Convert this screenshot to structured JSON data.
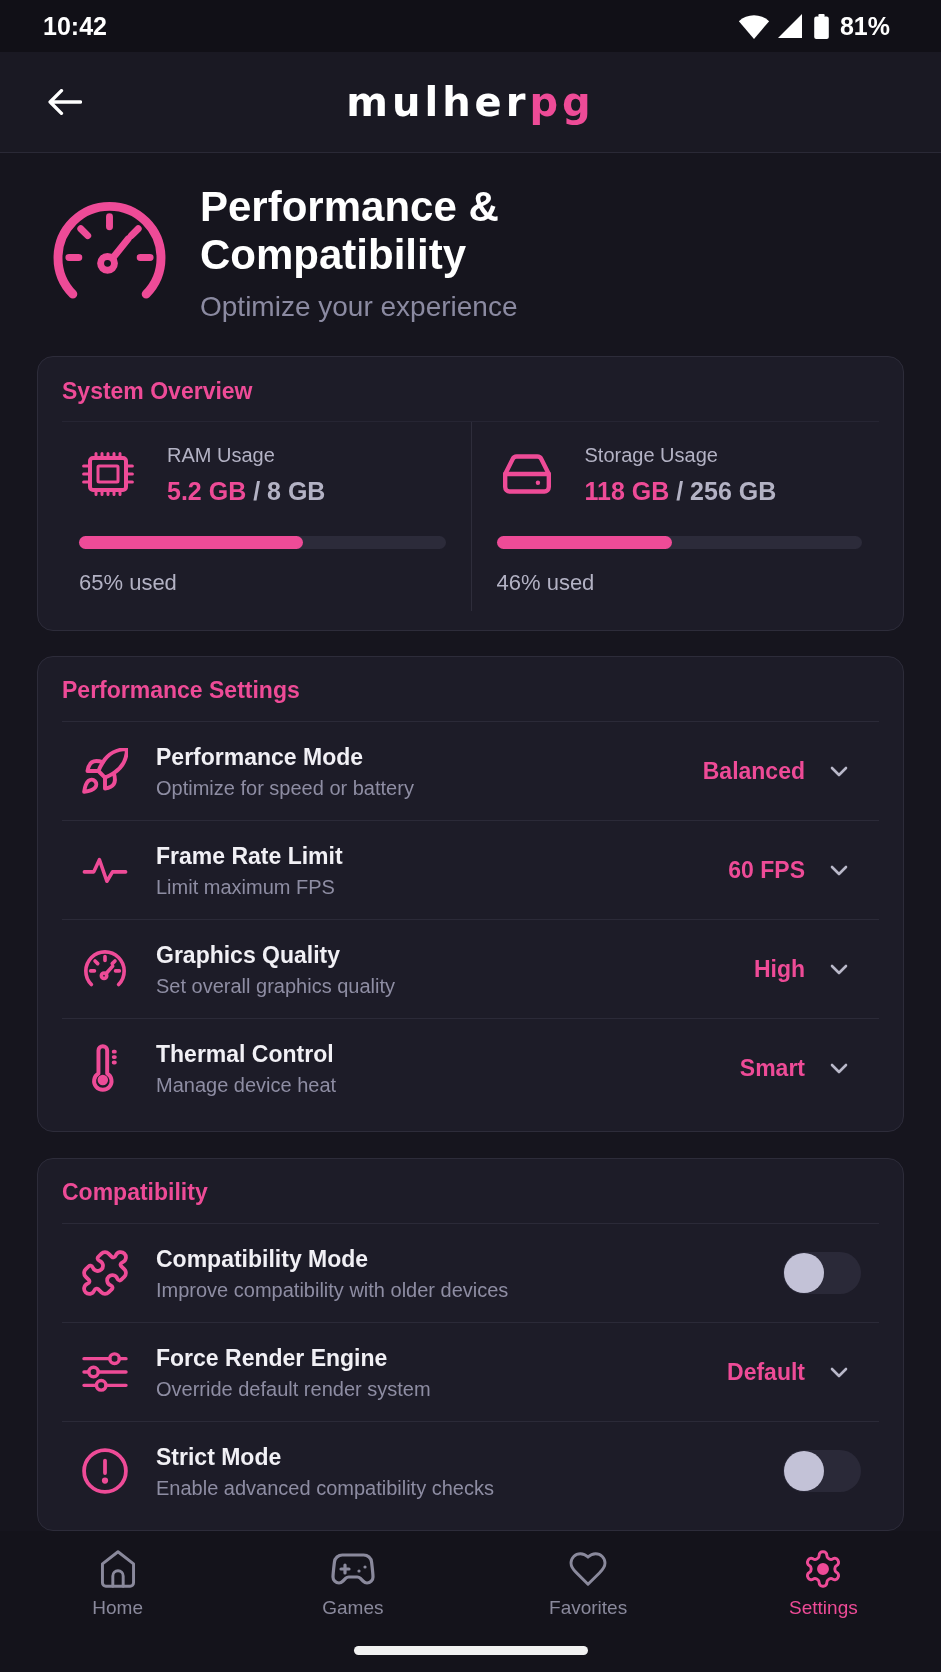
{
  "status_bar": {
    "time": "10:42",
    "battery": "81%"
  },
  "header": {
    "logo": "mulher",
    "logo_accent": "pg"
  },
  "page_header": {
    "title": "Performance & Compatibility",
    "subtitle": "Optimize your experience"
  },
  "system_overview": {
    "title": "System Overview",
    "meters": [
      {
        "label": "RAM Usage",
        "used": "5.2 GB",
        "total": "/ 8 GB",
        "level": 0.61,
        "caption": "65% used"
      },
      {
        "label": "Storage Usage",
        "used": "118 GB",
        "total": "/ 256 GB",
        "level": 0.48,
        "caption": "46% used"
      }
    ]
  },
  "sections": [
    {
      "title": "Performance Settings",
      "rows": [
        {
          "kind": "dropdown",
          "title": "Performance Mode",
          "description": "Optimize for speed or battery",
          "value": "Balanced"
        },
        {
          "kind": "dropdown",
          "title": "Frame Rate Limit",
          "description": "Limit maximum FPS",
          "value": "60 FPS"
        },
        {
          "kind": "dropdown",
          "title": "Graphics Quality",
          "description": "Set overall graphics quality",
          "value": "High"
        },
        {
          "kind": "dropdown",
          "title": "Thermal Control",
          "description": "Manage device heat",
          "value": "Smart"
        }
      ]
    },
    {
      "title": "Compatibility",
      "rows": [
        {
          "kind": "toggle",
          "title": "Compatibility Mode",
          "description": "Improve compatibility with older devices",
          "on": false
        },
        {
          "kind": "dropdown",
          "title": "Force Render Engine",
          "description": "Override default render system",
          "value": "Default"
        },
        {
          "kind": "toggle",
          "title": "Strict Mode",
          "description": "Enable advanced compatibility checks",
          "on": false
        }
      ]
    }
  ],
  "bottom_nav": {
    "items": [
      {
        "label": "Home",
        "selected": false
      },
      {
        "label": "Games",
        "selected": false
      },
      {
        "label": "Favorites",
        "selected": false
      },
      {
        "label": "Settings",
        "selected": true
      }
    ]
  }
}
